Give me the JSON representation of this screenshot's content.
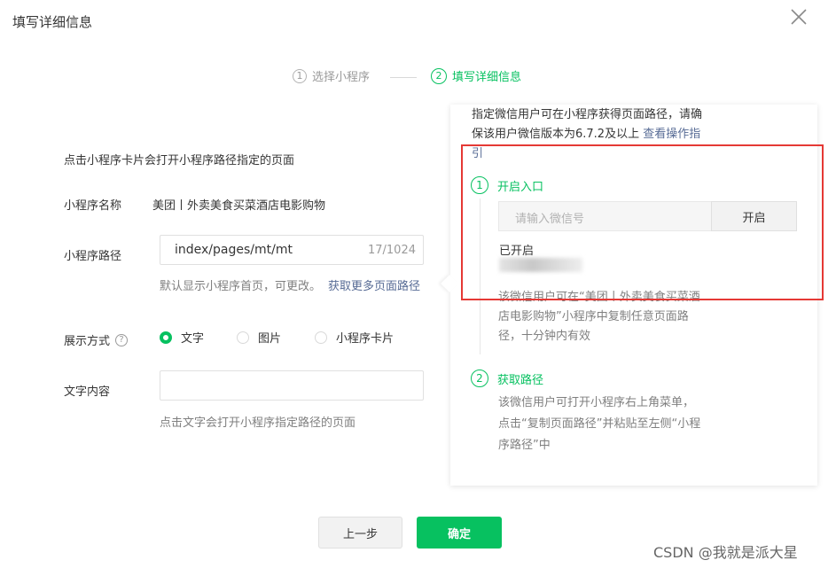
{
  "dialog": {
    "title": "填写详细信息"
  },
  "steps": [
    {
      "num": "1",
      "label": "选择小程序"
    },
    {
      "num": "2",
      "label": "填写详细信息"
    }
  ],
  "form": {
    "description": "点击小程序卡片会打开小程序路径指定的页面",
    "name_label": "小程序名称",
    "name_value": "美团丨外卖美食买菜酒店电影购物",
    "path_label": "小程序路径",
    "path_value": "index/pages/mt/mt",
    "path_count": "17/1024",
    "path_hint": "默认显示小程序首页，可更改。",
    "path_link": "获取更多页面路径",
    "display_label": "展示方式",
    "display_help_icon": "?",
    "display_options": [
      "文字",
      "图片",
      "小程序卡片"
    ],
    "display_selected": "文字",
    "text_label": "文字内容",
    "text_value": "",
    "text_hint": "点击文字会打开小程序指定路径的页面"
  },
  "panel": {
    "intro": "指定微信用户可在小程序获得页面路径，请确保该用户微信版本为6.7.2及以上",
    "intro_link": "查看操作指引",
    "step1": {
      "num": "1",
      "title": "开启入口"
    },
    "wechat_placeholder": "请输入微信号",
    "open_button": "开启",
    "opened_label": "已开启",
    "step1_desc": "该微信用户可在“美团丨外卖美食买菜酒店电影购物”小程序中复制任意页面路径，十分钟内有效",
    "step2": {
      "num": "2",
      "title": "获取路径"
    },
    "step2_desc": "该微信用户可打开小程序右上角菜单，点击“复制页面路径”并粘贴至左侧“小程序路径”中"
  },
  "footer": {
    "prev_label": "上一步",
    "ok_label": "确定"
  },
  "watermark": "CSDN @我就是派大星",
  "colors": {
    "accent": "#07c160",
    "link": "#576b95",
    "highlight": "#e53935"
  }
}
